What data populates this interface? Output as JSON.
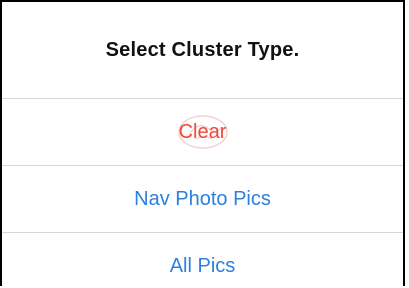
{
  "dialog": {
    "title": "Select Cluster Type."
  },
  "actions": [
    {
      "label": "Clear",
      "color": "#f0483b"
    },
    {
      "label": "Nav Photo Pics",
      "color": "#2d7fe0"
    },
    {
      "label": "All Pics",
      "color": "#2d7fe0"
    }
  ],
  "watermark_icon": "faint-watermark-icon"
}
